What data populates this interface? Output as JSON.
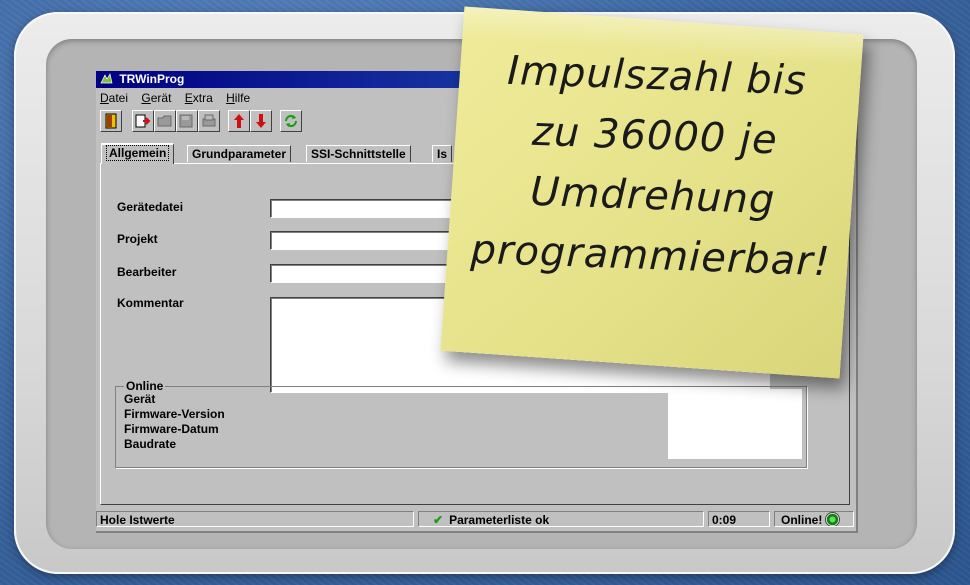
{
  "window": {
    "title": "TRWinProg",
    "menu": [
      {
        "underlined": "D",
        "rest": "atei"
      },
      {
        "underlined": "G",
        "rest": "erät"
      },
      {
        "underlined": "E",
        "rest": "xtra"
      },
      {
        "underlined": "H",
        "rest": "ilfe"
      }
    ],
    "toolbar_icons": [
      "exit-door-icon",
      "send-to-device-icon",
      "open-icon",
      "save-icon",
      "print-icon",
      "arrow-up-icon",
      "arrow-down-icon",
      "refresh-icon"
    ],
    "tabs": [
      "Allgemein",
      "Grundparameter",
      "SSI-Schnittstelle",
      "Is"
    ],
    "active_tab": "Allgemein",
    "fields": {
      "geraetedatei": {
        "label": "Gerätedatei",
        "value": ""
      },
      "projekt": {
        "label": "Projekt",
        "value": ""
      },
      "bearbeiter": {
        "label": "Bearbeiter",
        "value": ""
      },
      "kommentar": {
        "label": "Kommentar",
        "value": ""
      }
    },
    "online_group": {
      "title": "Online",
      "rows": [
        "Gerät",
        "Firmware-Version",
        "Firmware-Datum",
        "Baudrate"
      ]
    },
    "statusbar": {
      "action": "Hole Istwerte",
      "param_status": "Parameterliste ok",
      "time": "0:09",
      "connection": "Online!"
    }
  },
  "note": {
    "lines": [
      "Impulszahl bis",
      "zu 36000 je",
      "Umdrehung",
      "programmierbar!"
    ],
    "color": "#e9e58e"
  },
  "colors": {
    "background": "#3f6aa6",
    "titlebar": "#000080",
    "window": "#c0c0c0",
    "arrow_red": "#d01010",
    "refresh_green": "#10a010"
  }
}
